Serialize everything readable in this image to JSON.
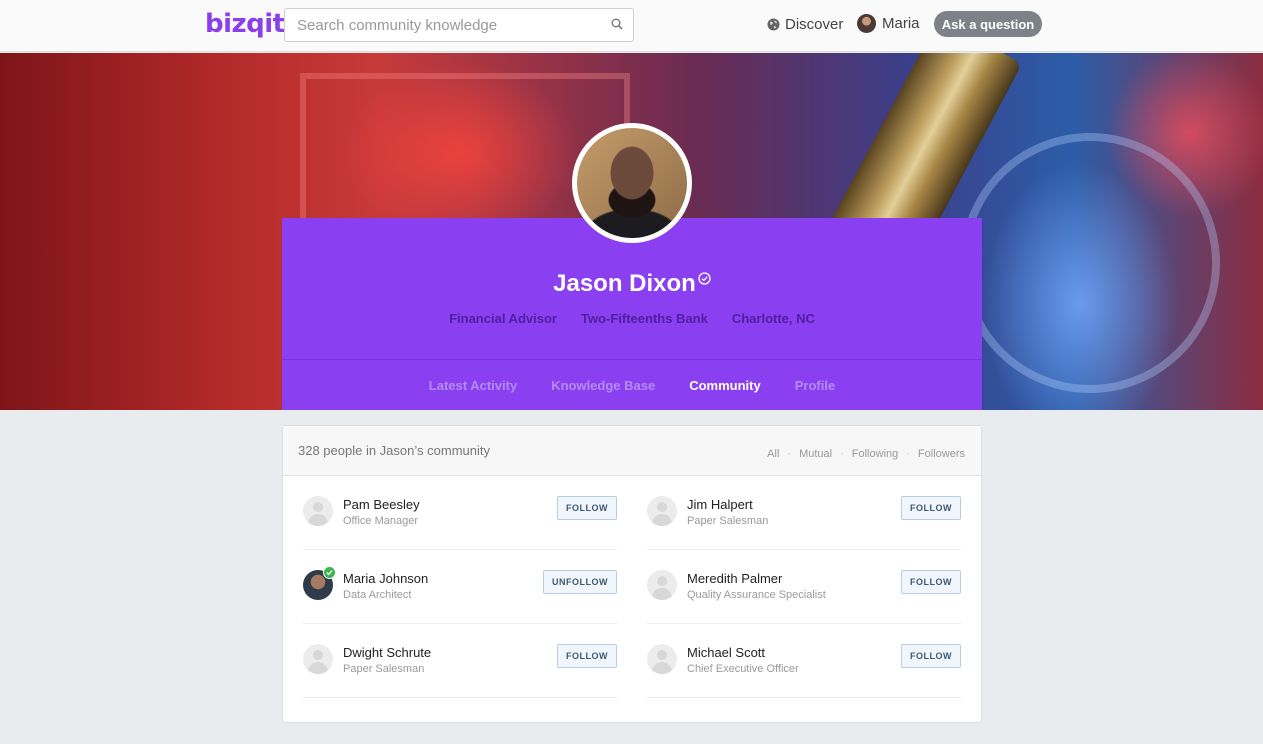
{
  "nav": {
    "logo": "bizqit",
    "search_placeholder": "Search community knowledge",
    "discover_label": "Discover",
    "user_name": "Maria",
    "ask_button": "Ask a question"
  },
  "profile": {
    "name": "Jason Dixon",
    "verified": true,
    "job_title": "Financial Advisor",
    "company": "Two-Fifteenths Bank",
    "location": "Charlotte, NC",
    "tabs": [
      {
        "label": "Latest Activity",
        "active": false
      },
      {
        "label": "Knowledge Base",
        "active": false
      },
      {
        "label": "Community",
        "active": true
      },
      {
        "label": "Profile",
        "active": false
      }
    ]
  },
  "community": {
    "summary": "328 people in Jason’s community",
    "filters": [
      "All",
      "Mutual",
      "Following",
      "Followers"
    ],
    "people": [
      {
        "name": "Pam Beesley",
        "title": "Office Manager",
        "button": "FOLLOW"
      },
      {
        "name": "Jim Halpert",
        "title": "Paper Salesman",
        "button": "FOLLOW"
      },
      {
        "name": "Maria Johnson",
        "title": "Data Architect",
        "button": "UNFOLLOW"
      },
      {
        "name": "Meredith Palmer",
        "title": "Quality Assurance Specialist",
        "button": "FOLLOW"
      },
      {
        "name": "Dwight Schrute",
        "title": "Paper Salesman",
        "button": "FOLLOW"
      },
      {
        "name": "Michael Scott",
        "title": "Chief Executive Officer",
        "button": "FOLLOW"
      }
    ]
  },
  "colors": {
    "brand_purple": "#8a3ff0",
    "verified_green": "#3bb54a"
  }
}
